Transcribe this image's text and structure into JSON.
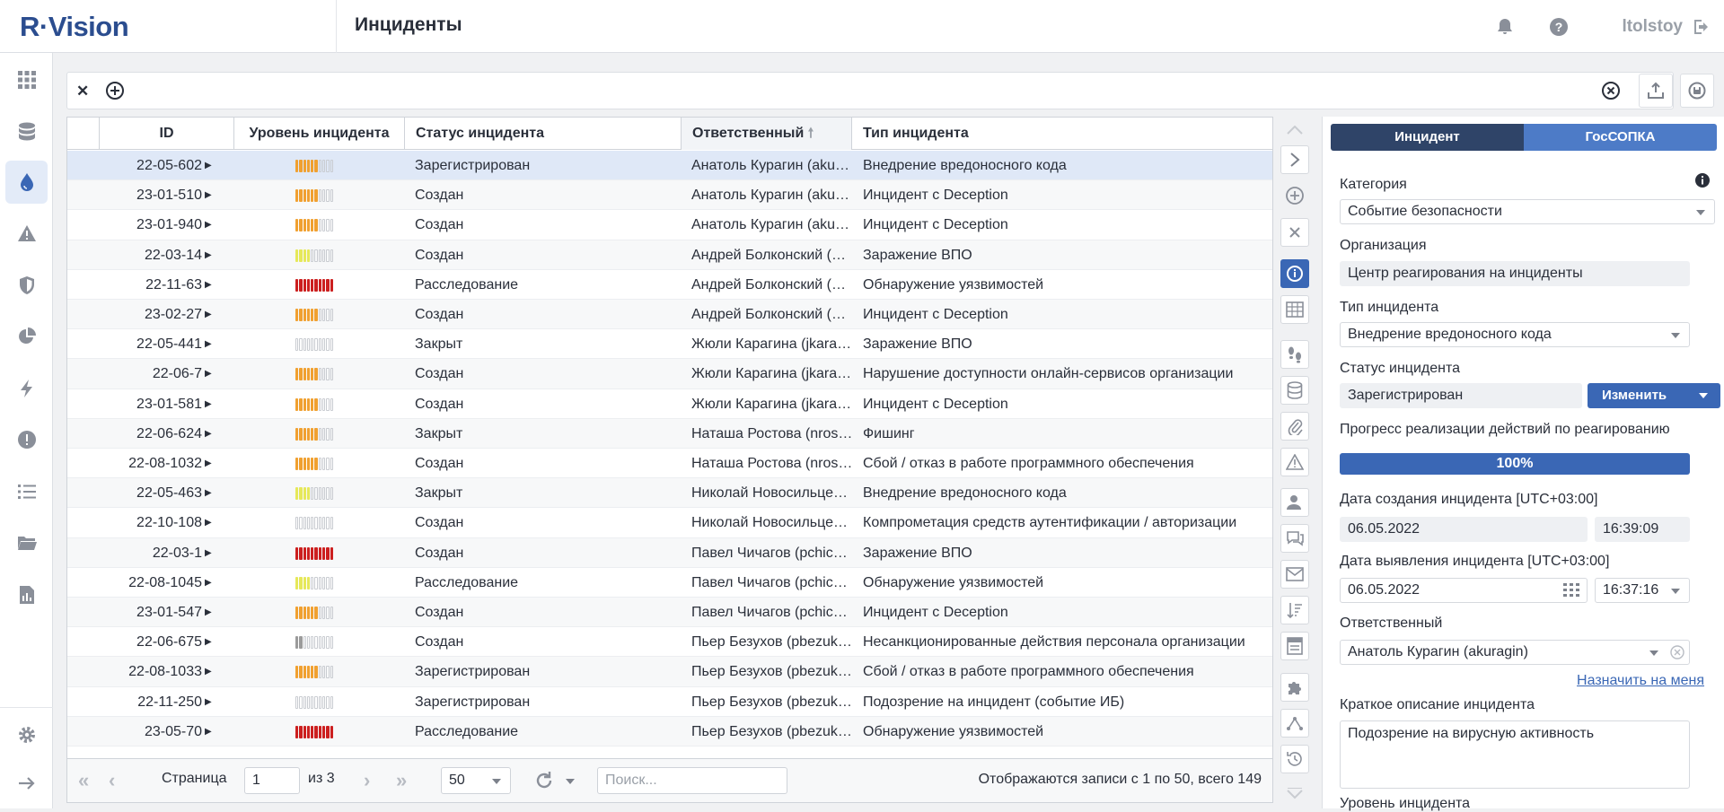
{
  "app": {
    "logo": "R·Vision",
    "title": "Инциденты",
    "user": "ltolstoy"
  },
  "grid": {
    "columns": {
      "id": "ID",
      "level": "Уровень инцидента",
      "status": "Статус инцидента",
      "responsible": "Ответственный",
      "type": "Тип инцидента"
    },
    "rows": [
      {
        "id": "22-05-602",
        "level": 6,
        "level_color": "#f0a030",
        "status": "Зарегистрирован",
        "responsible": "Анатоль Курагин (akuragin)",
        "type": "Внедрение вредоносного кода"
      },
      {
        "id": "23-01-510",
        "level": 6,
        "level_color": "#f0a030",
        "status": "Создан",
        "responsible": "Анатоль Курагин (akuragin)",
        "type": "Инцидент с Deception"
      },
      {
        "id": "23-01-940",
        "level": 6,
        "level_color": "#f0a030",
        "status": "Создан",
        "responsible": "Анатоль Курагин (akuragin)",
        "type": "Инцидент с Deception"
      },
      {
        "id": "22-03-14",
        "level": 4,
        "level_color": "#e6e85a",
        "status": "Создан",
        "responsible": "Андрей Болконский (abolkonsky)",
        "type": "Заражение ВПО"
      },
      {
        "id": "22-11-63",
        "level": 10,
        "level_color": "#cc1f1f",
        "status": "Расследование",
        "responsible": "Андрей Болконский (abolkonsky)",
        "type": "Обнаружение уязвимостей"
      },
      {
        "id": "23-02-27",
        "level": 6,
        "level_color": "#f0a030",
        "status": "Создан",
        "responsible": "Андрей Болконский (abolkonsky)",
        "type": "Инцидент с Deception"
      },
      {
        "id": "22-05-441",
        "level": 0,
        "level_color": "#ffffff",
        "status": "Закрыт",
        "responsible": "Жюли Карагина (jkaragina)",
        "type": "Заражение ВПО"
      },
      {
        "id": "22-06-7",
        "level": 6,
        "level_color": "#f0a030",
        "status": "Создан",
        "responsible": "Жюли Карагина (jkaragina)",
        "type": "Нарушение доступности онлайн-сервисов организации"
      },
      {
        "id": "23-01-581",
        "level": 6,
        "level_color": "#f0a030",
        "status": "Создан",
        "responsible": "Жюли Карагина (jkaragina)",
        "type": "Инцидент с Deception"
      },
      {
        "id": "22-06-624",
        "level": 6,
        "level_color": "#f0a030",
        "status": "Закрыт",
        "responsible": "Наташа Ростова (nrostova)",
        "type": "Фишинг"
      },
      {
        "id": "22-08-1032",
        "level": 6,
        "level_color": "#f0a030",
        "status": "Создан",
        "responsible": "Наташа Ростова (nrostova)",
        "type": "Сбой / отказ в работе программного обеспечения"
      },
      {
        "id": "22-05-463",
        "level": 4,
        "level_color": "#e6e85a",
        "status": "Закрыт",
        "responsible": "Николай Новосильцев (nnovosiltsev)",
        "type": "Внедрение вредоносного кода"
      },
      {
        "id": "22-10-108",
        "level": 0,
        "level_color": "#ffffff",
        "status": "Создан",
        "responsible": "Николай Новосильцев (nnovosiltsev)",
        "type": "Компрометация средств аутентификации / авторизации"
      },
      {
        "id": "22-03-1",
        "level": 10,
        "level_color": "#cc1f1f",
        "status": "Создан",
        "responsible": "Павел Чичагов (pchichagov)",
        "type": "Заражение ВПО"
      },
      {
        "id": "22-08-1045",
        "level": 4,
        "level_color": "#e6e85a",
        "status": "Расследование",
        "responsible": "Павел Чичагов (pchichagov)",
        "type": "Обнаружение уязвимостей"
      },
      {
        "id": "23-01-547",
        "level": 6,
        "level_color": "#f0a030",
        "status": "Создан",
        "responsible": "Павел Чичагов (pchichagov)",
        "type": "Инцидент с Deception"
      },
      {
        "id": "22-06-675",
        "level": 2,
        "level_color": "#9b9b9b",
        "status": "Создан",
        "responsible": "Пьер Безухов (pbezukhov)",
        "type": "Несанкционированные действия персонала организации"
      },
      {
        "id": "22-08-1033",
        "level": 6,
        "level_color": "#f0a030",
        "status": "Зарегистрирован",
        "responsible": "Пьер Безухов (pbezukhov)",
        "type": "Сбой / отказ в работе программного обеспечения"
      },
      {
        "id": "22-11-250",
        "level": 0,
        "level_color": "#ffffff",
        "status": "Зарегистрирован",
        "responsible": "Пьер Безухов (pbezukhov)",
        "type": "Подозрение на инцидент (событие ИБ)"
      },
      {
        "id": "23-05-70",
        "level": 10,
        "level_color": "#cc1f1f",
        "status": "Расследование",
        "responsible": "Пьер Безухов (pbezukhov)",
        "type": "Обнаружение уязвимостей"
      }
    ],
    "selected_row": 0
  },
  "pager": {
    "page_label": "Страница",
    "page": "1",
    "of_label": "из 3",
    "page_size": "50",
    "search_placeholder": "Поиск...",
    "info": "Отображаются записи с 1 по 50, всего 149"
  },
  "panel": {
    "tab_incident": "Инцидент",
    "tab_gossopka": "ГосСОПКА",
    "category_label": "Категория",
    "category_value": "Событие безопасности",
    "org_label": "Организация",
    "org_value": "Центр реагирования на инциденты",
    "type_label": "Тип инцидента",
    "type_value": "Внедрение вредоносного кода",
    "status_label": "Статус инцидента",
    "status_value": "Зарегистрирован",
    "change_button": "Изменить",
    "progress_label": "Прогресс реализации действий по реагированию",
    "progress_value": "100%",
    "created_label": "Дата создания инцидента [UTC+03:00]",
    "created_date": "06.05.2022",
    "created_time": "16:39:09",
    "detected_label": "Дата выявления инцидента [UTC+03:00]",
    "detected_date": "06.05.2022",
    "detected_time": "16:37:16",
    "responsible_label": "Ответственный",
    "responsible_value": "Анатоль Курагин (akuragin)",
    "assign_me": "Назначить на меня",
    "desc_label": "Краткое описание инцидента",
    "desc_value": "Подозрение на вирусную активность",
    "level_label": "Уровень инцидента"
  }
}
